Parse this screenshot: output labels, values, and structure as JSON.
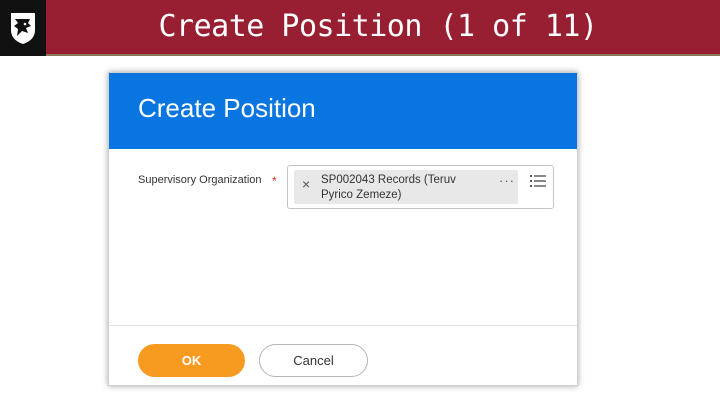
{
  "slide": {
    "title": "Create Position (1 of 11)"
  },
  "dialog": {
    "title": "Create Position",
    "field": {
      "label": "Supervisory Organization",
      "required_mark": "*",
      "selected_value": "SP002043 Records (Teruv Pyrico Zemeze)",
      "remove_glyph": "×",
      "more_glyph": "···"
    },
    "buttons": {
      "ok_label": "OK",
      "cancel_label": "Cancel"
    }
  },
  "colors": {
    "banner": "#981e32",
    "dialog_header": "#0875e1",
    "ok_button": "#f79a20",
    "required": "#de2e21"
  },
  "icons": {
    "logo": "cougar-head-logo-icon",
    "list": "list-icon",
    "remove": "close-icon",
    "more": "more-options-icon"
  }
}
